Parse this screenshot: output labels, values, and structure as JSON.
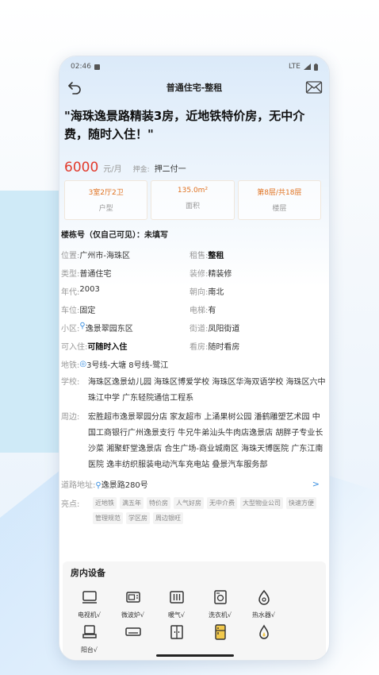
{
  "status": {
    "time": "02:46",
    "network": "LTE"
  },
  "nav": {
    "title": "普通住宅-整租"
  },
  "headline": "\"海珠逸景路精装3房，近地铁特价房，无中介费，随时入住！\"",
  "price": {
    "amount": "6000",
    "unit": "元/月",
    "deposit_label": "押金:",
    "deposit_value": "押二付一"
  },
  "stats": [
    {
      "value": "3室2厅2卫",
      "label": "户型"
    },
    {
      "value": "135.0m²",
      "label": "面积"
    },
    {
      "value": "第8层/共18层",
      "label": "楼层"
    }
  ],
  "building": "楼栋号（仅自己可见）：未填写",
  "details": {
    "location": {
      "label": "位置:",
      "value": "广州市-海珠区"
    },
    "rent": {
      "label": "租售:",
      "value": "整租"
    },
    "type": {
      "label": "类型:",
      "value": "普通住宅"
    },
    "decor": {
      "label": "装修:",
      "value": "精装修"
    },
    "year": {
      "label": "年代:",
      "value": "2003"
    },
    "facing": {
      "label": "朝向:",
      "value": "南北"
    },
    "parking": {
      "label": "车位:",
      "value": "固定"
    },
    "elevator": {
      "label": "电梯:",
      "value": "有"
    },
    "community": {
      "label": "小区:",
      "value": "逸景翠园东区"
    },
    "street": {
      "label": "街道:",
      "value": "凤阳街道"
    },
    "movein": {
      "label": "可入住:",
      "value": "可随时入住"
    },
    "viewing": {
      "label": "看房:",
      "value": "随时看房"
    },
    "metro": {
      "label": "地铁:",
      "value": "3号线-大塘 8号线-鹭江"
    },
    "school": {
      "label": "学校:",
      "value": "海珠区逸景幼儿园 海珠区博爱学校 海珠区华海双语学校 海珠区六中珠江中学 广东轻院通信工程系"
    },
    "nearby": {
      "label": "周边:",
      "value": "宏胜超市逸景翠园分店 家友超市 上涌果树公园 潘鹤雕塑艺术园 中国工商银行广州逸景支行 牛兄牛弟汕头牛肉店逸景店 胡胖子专业长沙菜 湘聚虾堂逸景店 合生广场-商业城南区 海珠天博医院 广东江南医院 逸丰纺织服装电动汽车充电站 叠景汽车服务部"
    },
    "road": {
      "label": "道路地址:",
      "value": "逸景路280号",
      "arrow": ">"
    },
    "highlights": {
      "label": "亮点:",
      "tags": [
        "近地铁",
        "满五年",
        "特价房",
        "人气好房",
        "无中介费",
        "大型物业公司",
        "快速方便",
        "管理规范",
        "学区房",
        "周边银旺"
      ]
    }
  },
  "facilities": {
    "title": "房内设备",
    "items": [
      "电视机√",
      "微波炉√",
      "暖气√",
      "洗衣机√",
      "热水器√",
      "阳台√",
      "",
      "",
      "",
      "",
      "",
      ""
    ]
  }
}
